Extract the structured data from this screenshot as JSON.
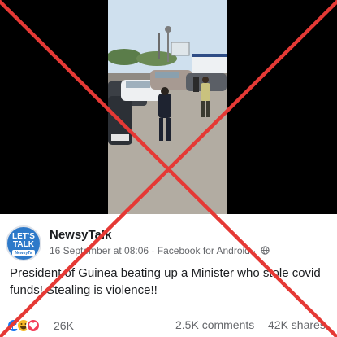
{
  "post": {
    "page_name": "NewsyTalk",
    "avatar": {
      "line1": "LET'S",
      "line2": "TALK",
      "sub": "NewsyTa"
    },
    "date": "16 September at 08:06",
    "separator": "·",
    "via": "Facebook for Android",
    "separator2": "·",
    "privacy_icon": "globe-icon",
    "text": "President of Guinea beating up a Minister who stole covid funds! Stealing is violence!!"
  },
  "engagement": {
    "reaction_icons": [
      "like-icon",
      "haha-icon",
      "love-icon"
    ],
    "reactions_count": "26K",
    "comments": "2.5K comments",
    "shares": "42K shares"
  },
  "overlay": {
    "mark": "red-cross",
    "color": "#e53935"
  },
  "colors": {
    "link_blue": "#1877f2",
    "meta_grey": "#65676b"
  }
}
